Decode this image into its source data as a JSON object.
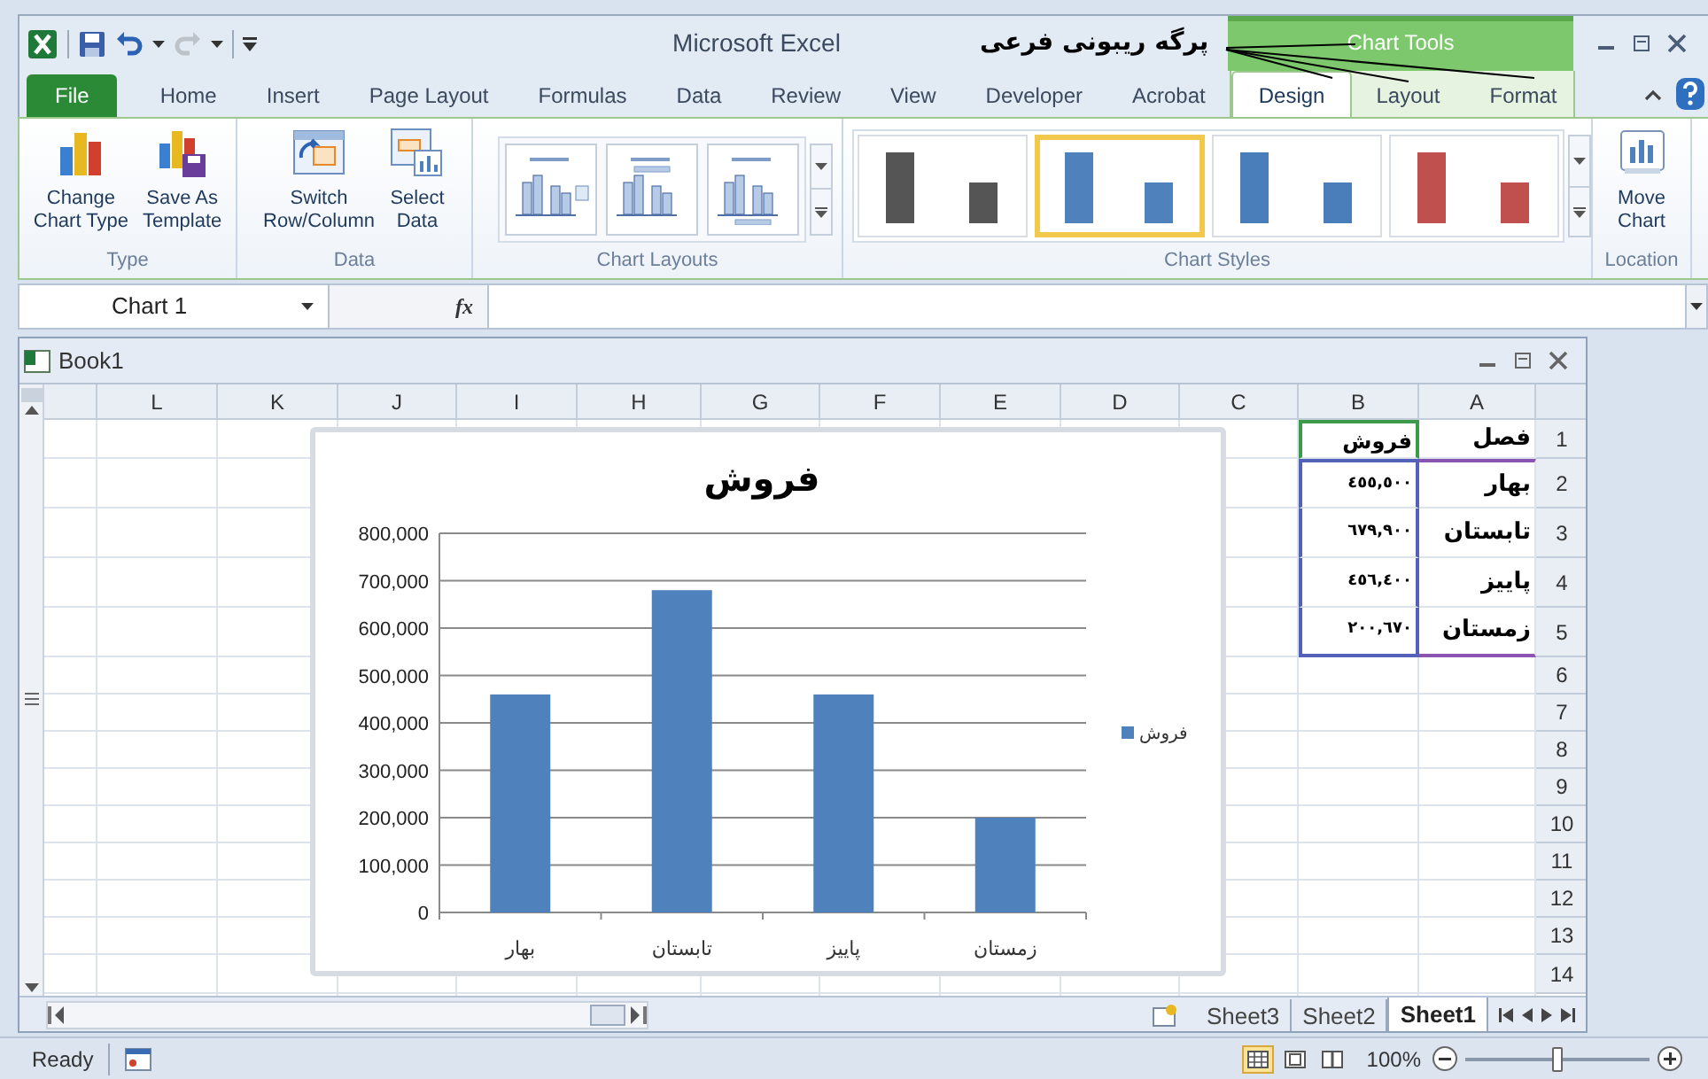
{
  "window": {
    "title": "Microsoft Excel"
  },
  "annotation": {
    "text": "پرگه ریبونی فرعی"
  },
  "contextual_group": {
    "title": "Chart Tools"
  },
  "quick_access": [
    {
      "kind": "save",
      "disabled": false
    },
    {
      "kind": "undo",
      "disabled": false
    },
    {
      "kind": "redo",
      "disabled": true
    }
  ],
  "tabs": [
    {
      "label": "File",
      "kind": "file",
      "selected": false
    },
    {
      "label": "Home",
      "kind": "normal",
      "selected": false
    },
    {
      "label": "Insert",
      "kind": "normal",
      "selected": false
    },
    {
      "label": "Page Layout",
      "kind": "normal",
      "selected": false
    },
    {
      "label": "Formulas",
      "kind": "normal",
      "selected": false
    },
    {
      "label": "Data",
      "kind": "normal",
      "selected": false
    },
    {
      "label": "Review",
      "kind": "normal",
      "selected": false
    },
    {
      "label": "View",
      "kind": "normal",
      "selected": false
    },
    {
      "label": "Developer",
      "kind": "normal",
      "selected": false
    },
    {
      "label": "Acrobat",
      "kind": "normal",
      "selected": false
    },
    {
      "label": "Design",
      "kind": "contextual",
      "selected": true
    },
    {
      "label": "Layout",
      "kind": "contextual",
      "selected": false
    },
    {
      "label": "Format",
      "kind": "contextual",
      "selected": false
    }
  ],
  "ribbon": {
    "groups": [
      {
        "label": "Type",
        "kind": "buttons",
        "buttons": [
          {
            "lines": [
              "Change",
              "Chart Type"
            ]
          },
          {
            "lines": [
              "Save As",
              "Template"
            ]
          }
        ]
      },
      {
        "label": "Data",
        "kind": "buttons",
        "buttons": [
          {
            "lines": [
              "Switch",
              "Row/Column"
            ]
          },
          {
            "lines": [
              "Select",
              "Data"
            ]
          }
        ]
      },
      {
        "label": "Chart Layouts",
        "kind": "layouts",
        "layouts": [
          {
            "kind": "legend-right"
          },
          {
            "kind": "labels-top"
          },
          {
            "kind": "axis-titles"
          }
        ]
      },
      {
        "label": "Chart Styles",
        "kind": "styles",
        "styles": [
          {
            "color": "#555555",
            "selected": false
          },
          {
            "color": "#4f81bd",
            "selected": true
          },
          {
            "color": "#4a7ebb",
            "selected": false
          },
          {
            "color": "#c0504d",
            "selected": false
          }
        ]
      },
      {
        "label": "Location",
        "kind": "buttons",
        "buttons": [
          {
            "lines": [
              "Move",
              "Chart"
            ]
          }
        ]
      }
    ]
  },
  "formula_bar": {
    "name_box": "Chart 1",
    "fx": "fx"
  },
  "workbook": {
    "title": "Book1"
  },
  "sheet": {
    "columns": [
      "L",
      "K",
      "J",
      "I",
      "H",
      "G",
      "F",
      "E",
      "D",
      "C",
      "B",
      "A"
    ],
    "rows": [
      {
        "number": "1",
        "a": "فصل",
        "b": "فروش"
      },
      {
        "number": "2",
        "a": "بهار",
        "b": "٤٥٥,٥٠٠"
      },
      {
        "number": "3",
        "a": "تابستان",
        "b": "٦٧٩,٩٠٠"
      },
      {
        "number": "4",
        "a": "پاییز",
        "b": "٤٥٦,٤٠٠"
      },
      {
        "number": "5",
        "a": "زمستان",
        "b": "٢٠٠,٦٧٠"
      },
      {
        "number": "6"
      },
      {
        "number": "7"
      },
      {
        "number": "8"
      },
      {
        "number": "9"
      },
      {
        "number": "10"
      },
      {
        "number": "11"
      },
      {
        "number": "12"
      },
      {
        "number": "13"
      },
      {
        "number": "14"
      }
    ]
  },
  "chart": {
    "chart_data": {
      "type": "bar",
      "title": "فروش",
      "categories": [
        "بهار",
        "تابستان",
        "پاییز",
        "زمستان"
      ],
      "series": [
        {
          "name": "فروش",
          "color": "#4f81bd",
          "values": [
            460000,
            680000,
            460000,
            200000
          ]
        }
      ],
      "grid": true,
      "ylim": [
        0,
        800000
      ],
      "yticks": [
        {
          "value": 0,
          "label": "0"
        },
        {
          "value": 100000,
          "label": "100,000"
        },
        {
          "value": 200000,
          "label": "200,000"
        },
        {
          "value": 300000,
          "label": "300,000"
        },
        {
          "value": 400000,
          "label": "400,000"
        },
        {
          "value": 500000,
          "label": "500,000"
        },
        {
          "value": 600000,
          "label": "600,000"
        },
        {
          "value": 700000,
          "label": "700,000"
        },
        {
          "value": 800000,
          "label": "800,000"
        }
      ]
    }
  },
  "sheet_tabs": [
    {
      "label": "Sheet3",
      "selected": false
    },
    {
      "label": "Sheet2",
      "selected": false
    },
    {
      "label": "Sheet1",
      "selected": true
    }
  ],
  "status_bar": {
    "ready": "Ready",
    "views": [
      {
        "kind": "normal",
        "selected": true
      },
      {
        "kind": "page-layout",
        "selected": false
      },
      {
        "kind": "page-break",
        "selected": false
      }
    ],
    "zoom": "100%",
    "zoom_slider": {
      "level": 0.5
    }
  }
}
